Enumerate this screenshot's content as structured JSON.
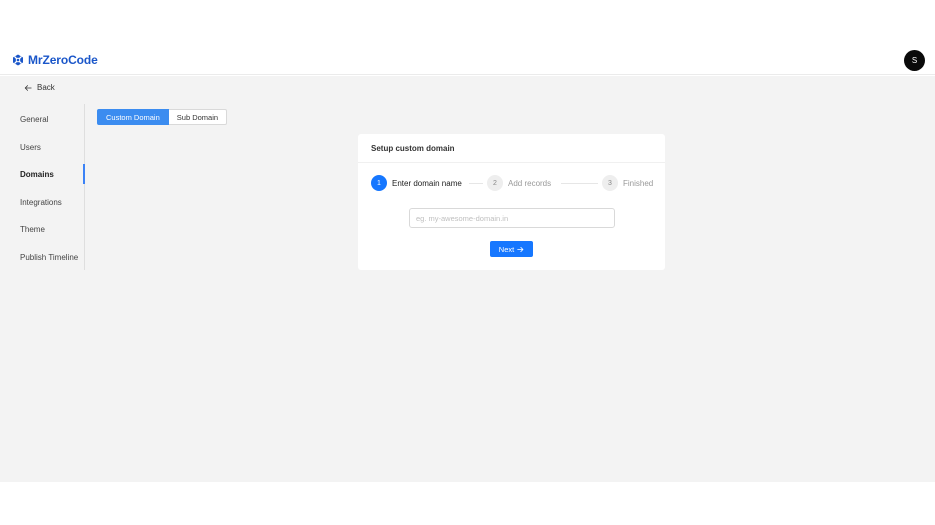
{
  "header": {
    "brand_name": "MrZeroCode",
    "brand_icon": "logo-icon",
    "avatar_initial": "S"
  },
  "back": {
    "label": "Back",
    "icon": "arrow-left-icon"
  },
  "sidebar": {
    "items": [
      {
        "label": "General",
        "active": false
      },
      {
        "label": "Users",
        "active": false
      },
      {
        "label": "Domains",
        "active": true
      },
      {
        "label": "Integrations",
        "active": false
      },
      {
        "label": "Theme",
        "active": false
      },
      {
        "label": "Publish Timeline",
        "active": false
      }
    ]
  },
  "tabs": [
    {
      "label": "Custom Domain",
      "active": true
    },
    {
      "label": "Sub Domain",
      "active": false
    }
  ],
  "card": {
    "title": "Setup custom domain",
    "steps": [
      {
        "number": "1",
        "title": "Enter domain name",
        "status": "process"
      },
      {
        "number": "2",
        "title": "Add records",
        "status": "wait"
      },
      {
        "number": "3",
        "title": "Finished",
        "status": "wait"
      }
    ],
    "input": {
      "value": "",
      "placeholder": "eg. my-awesome-domain.in"
    },
    "next_label": "Next",
    "next_icon": "arrow-right-icon"
  },
  "colors": {
    "brand": "#1a56c9",
    "primary": "#1677ff",
    "tab_active": "#3b8cf0",
    "content_bg": "#f3f3f3"
  }
}
